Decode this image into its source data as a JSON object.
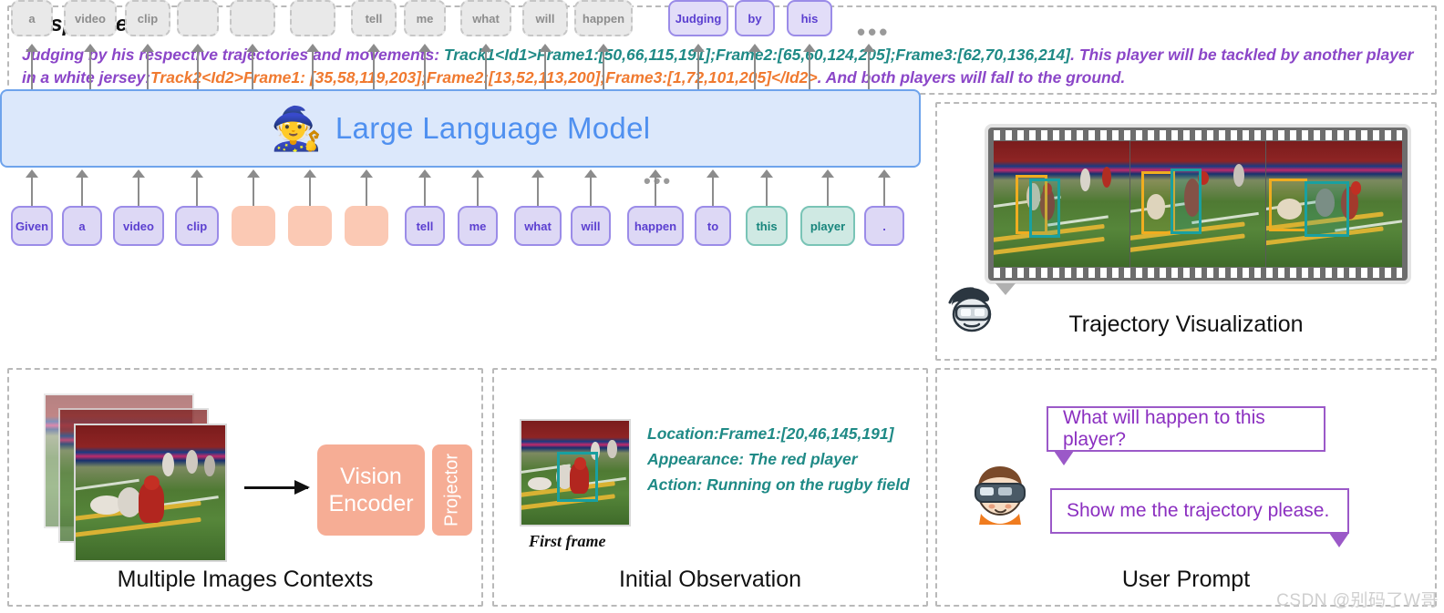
{
  "response": {
    "title": "Response:",
    "segments": [
      {
        "text": "Judging by his respective trajectories and movements: ",
        "color": "purple"
      },
      {
        "text": "Track1<Id1>Frame1:[50,66,115,191];Frame2:[65,60,124,205];Frame3:[62,70,136,214]",
        "color": "teal"
      },
      {
        "text": ". This player will be tackled by another player in a white jersey:",
        "color": "purple"
      },
      {
        "text": "Track2<Id2>Frame1: [35,58,119,203];Frame2:[13,52,113,200];Frame3:[1,72,101,205]</Id2>",
        "color": "orange"
      },
      {
        "text": ". And both players will fall to the ground.",
        "color": "purple"
      }
    ],
    "full_text": "Judging by his respective trajectories and movements: Track1<Id1>Frame1:[50,66,115,191];Frame2:[65,60,124,205];Frame3:[62,70,136,214]. This player will be tackled by another player in a white jersey:Track2<Id2>Frame1: [35,58,119,203];Frame2:[13,52,113,200];Frame3:[1,72,101,205]</Id2>. And both players will fall to the ground."
  },
  "llm": {
    "label": "Large Language Model",
    "icon": "wizard-icon",
    "icon_glyph": "🧙",
    "accent_color": "#4f90f0",
    "box_fill": "#dce8fb",
    "box_border": "#6ea3ec"
  },
  "output_tokens": [
    {
      "label": "a",
      "style": "gray"
    },
    {
      "label": "video",
      "style": "gray"
    },
    {
      "label": "clip",
      "style": "gray"
    },
    {
      "label": "",
      "style": "gray"
    },
    {
      "label": "",
      "style": "gray"
    },
    {
      "label": "",
      "style": "gray"
    },
    {
      "label": "tell",
      "style": "gray"
    },
    {
      "label": "me",
      "style": "gray"
    },
    {
      "label": "what",
      "style": "gray"
    },
    {
      "label": "will",
      "style": "gray"
    },
    {
      "label": "happen",
      "style": "gray"
    },
    {
      "label": "Judging",
      "style": "purple"
    },
    {
      "label": "by",
      "style": "purple"
    },
    {
      "label": "his",
      "style": "purple"
    }
  ],
  "output_trailing_ellipsis": "•••",
  "output_mid_ellipsis": "•••",
  "input_tokens": [
    {
      "label": "Given",
      "style": "purple"
    },
    {
      "label": "a",
      "style": "purple"
    },
    {
      "label": "video",
      "style": "purple"
    },
    {
      "label": "clip",
      "style": "purple"
    },
    {
      "label": "",
      "style": "salmon"
    },
    {
      "label": "",
      "style": "salmon"
    },
    {
      "label": "",
      "style": "salmon"
    },
    {
      "label": "tell",
      "style": "purple"
    },
    {
      "label": "me",
      "style": "purple"
    },
    {
      "label": "what",
      "style": "purple"
    },
    {
      "label": "will",
      "style": "purple"
    },
    {
      "label": "happen",
      "style": "purple"
    },
    {
      "label": "to",
      "style": "purple"
    },
    {
      "label": "this",
      "style": "teal"
    },
    {
      "label": "player",
      "style": "teal"
    },
    {
      "label": ".",
      "style": "purple"
    }
  ],
  "trajectory": {
    "caption": "Trajectory Visualization",
    "avatar_icon": "vr-headset-avatar-icon",
    "frames": [
      {
        "orange_box": true,
        "teal_box": true
      },
      {
        "orange_box": true,
        "teal_box": true
      },
      {
        "orange_box": true,
        "teal_box": true
      }
    ],
    "box_colors": {
      "track1": "#19a0a0",
      "track2": "#f0ad20"
    }
  },
  "multiple_images": {
    "caption": "Multiple Images Contexts",
    "vision_encoder_label": "Vision\nEncoder",
    "vision_encoder_line1": "Vision",
    "vision_encoder_line2": "Encoder",
    "projector_label": "Projector",
    "box_color": "#f6ad95",
    "image_count": 3
  },
  "initial_observation": {
    "caption": "Initial Observation",
    "first_frame_caption": "First frame",
    "lines": [
      "Location:Frame1:[20,46,145,191]",
      "Appearance: The red player",
      "Action: Running on the rugby field"
    ],
    "text_color": "#1f8a86",
    "bbox_color": "#19a0a0"
  },
  "user_prompt": {
    "caption": "User Prompt",
    "avatar_icon": "vr-user-avatar-icon",
    "bubbles": [
      "What will happen to this player?",
      "Show me the trajectory please."
    ],
    "accent_color": "#9b59c8"
  },
  "watermark": "CSDN @别码了W哥"
}
